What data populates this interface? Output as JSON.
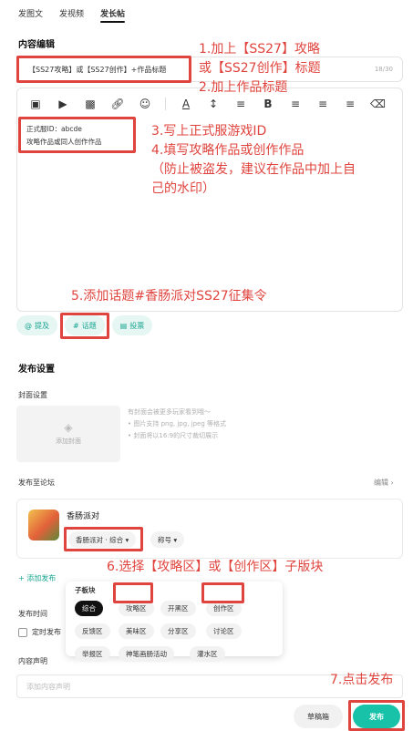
{
  "tabs": [
    "发图文",
    "发视频",
    "发长帖"
  ],
  "content_section_title": "内容编辑",
  "title_field": {
    "value": "【SS27攻略】或【SS27创作】+作品标题",
    "counter": "18/30"
  },
  "editor_body": {
    "line1": "正式服ID：abcde",
    "line2": "攻略作品或同人创作作品"
  },
  "chips": {
    "mention": "提及",
    "topic": "话题",
    "vote": "投票"
  },
  "publish_section_title": "发布设置",
  "cover": {
    "label": "封面设置",
    "add_label": "添加封面",
    "note1": "有封面会被更多玩家看到哦～",
    "note2": "图片支持 png, jpg, jpeg 等格式",
    "note3": "封面将以16:9的尺寸裁切展示"
  },
  "forum": {
    "label": "发布至论坛",
    "edit": "编辑",
    "name": "香肠派对",
    "board_select": "香肠派对 · 综合",
    "title_select": "称号"
  },
  "add_publish": "添加发布",
  "subboard_popup": {
    "label": "子板块",
    "items": [
      "综合",
      "攻略区",
      "开黑区",
      "创作区",
      "反馈区",
      "美味区",
      "分享区",
      "讨论区",
      "举报区",
      "神笔画肠活动",
      "灌水区"
    ]
  },
  "publish_time": {
    "label": "发布时间",
    "option": "定时发布"
  },
  "declaration": {
    "label": "内容声明",
    "placeholder": "添加内容声明"
  },
  "buttons": {
    "draft": "草稿箱",
    "publish": "发布"
  },
  "annotations": {
    "a1_line1": "1.加上【SS27】攻略",
    "a1_line2": "或【SS27创作】标题",
    "a2": "2.加上作品标题",
    "a3": "3.写上正式服游戏ID",
    "a4": "4.填写攻略作品或创作作品",
    "a4_note1": "（防止被盗发，建议在作品中加上自",
    "a4_note2": "己的水印）",
    "a5": "5.添加话题#香肠派对SS27征集令",
    "a6": "6.选择【攻略区】或【创作区】子版块",
    "a7": "7.点击发布"
  },
  "colors": {
    "accent": "#18a58f",
    "annotation": "#e0443e",
    "publish_btn": "#17c2a8"
  }
}
